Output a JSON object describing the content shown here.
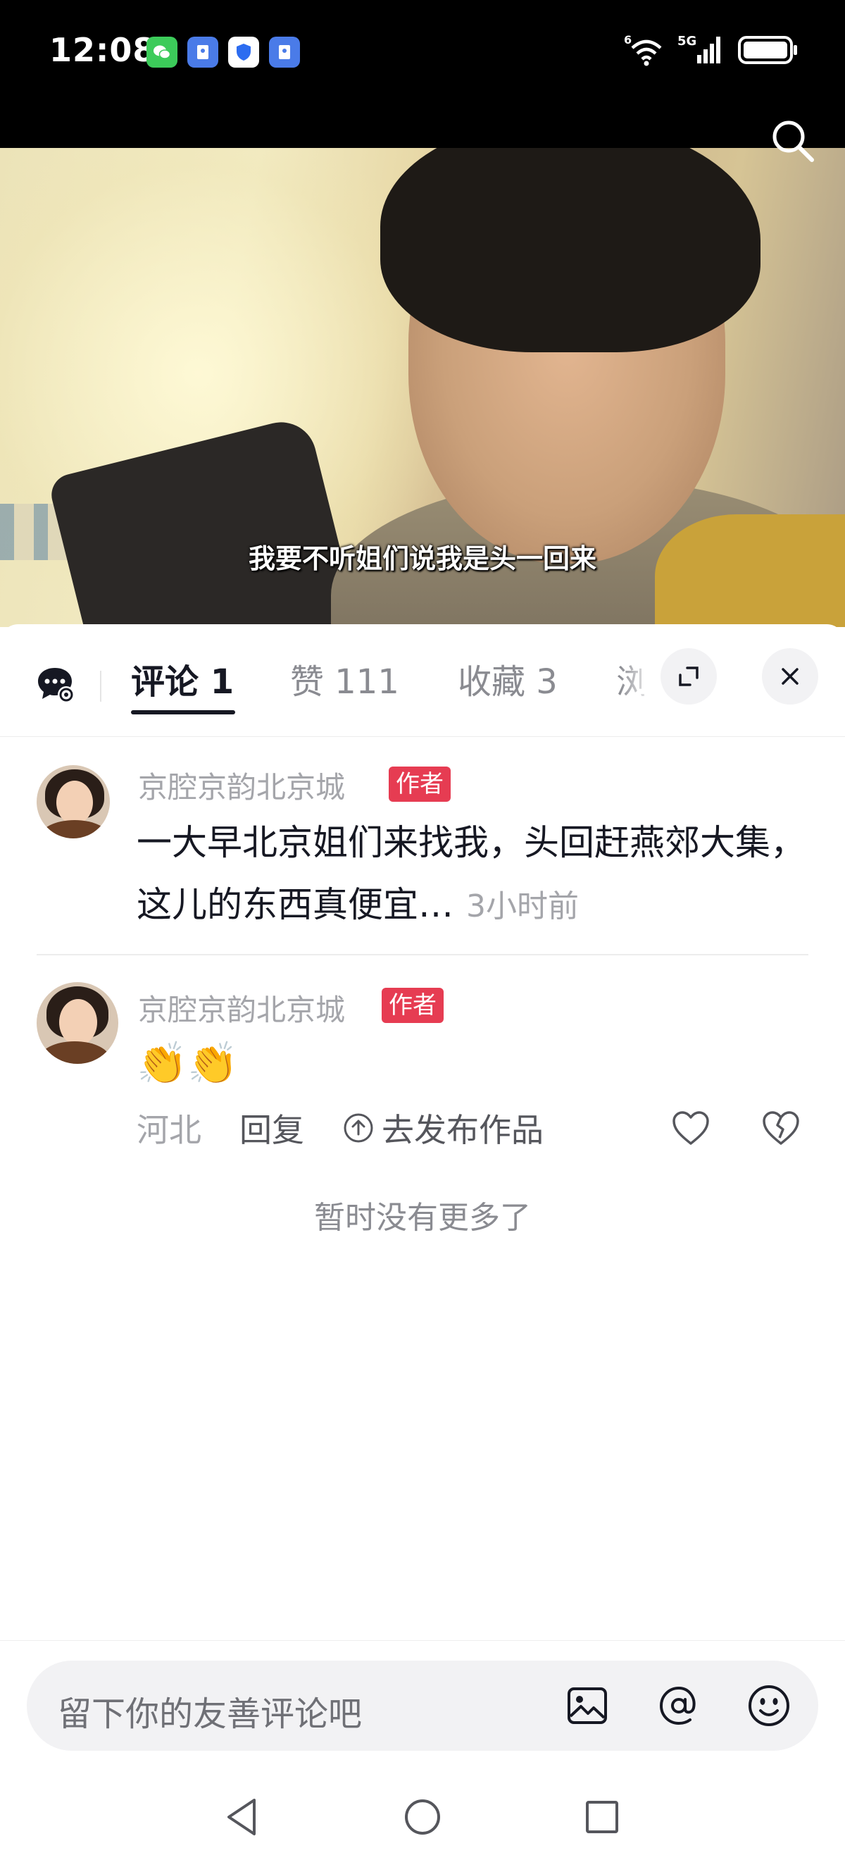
{
  "status_bar": {
    "time": "12:08",
    "app_icons": [
      "wechat-icon",
      "app-icon",
      "shield-icon",
      "app-icon"
    ],
    "network_label": "5G",
    "wifi_label": "6"
  },
  "video": {
    "subtitle": "我要不听姐们说我是头一回来"
  },
  "tabs": {
    "comments_label": "评论 1",
    "likes_label": "赞 111",
    "favorites_label": "收藏 3",
    "views_label": "浏"
  },
  "comments": [
    {
      "author": "京腔京韵北京城",
      "badge": "作者",
      "text": "一大早北京姐们来找我，头回赶燕郊大集，这儿的东西真便宜…",
      "time": "3小时前"
    },
    {
      "author": "京腔京韵北京城",
      "badge": "作者",
      "text": "👏👏",
      "location": "河北",
      "reply_label": "回复",
      "publish_label": "去发布作品"
    }
  ],
  "no_more_text": "暂时没有更多了",
  "input": {
    "placeholder": "留下你的友善评论吧"
  },
  "colors": {
    "badge": "#e63c52",
    "active_tab": "#161823",
    "muted_text": "#a4a5aa"
  }
}
